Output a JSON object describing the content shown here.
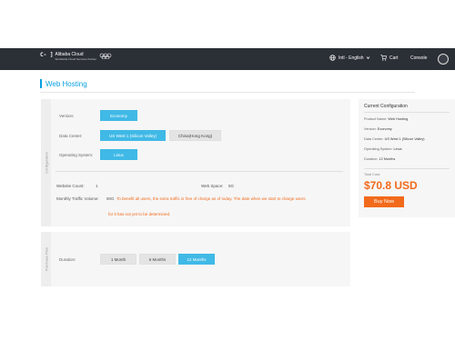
{
  "header": {
    "logo_brand": "Alibaba Cloud",
    "logo_tagline": "Worldwide Cloud Services Partner",
    "language": "Intl - English",
    "cart": "Cart",
    "console": "Console",
    "icons": [
      "alibaba-cloud-logo-icon",
      "olympic-rings-icon",
      "globe-icon",
      "chevron-down-icon",
      "cart-icon",
      "avatar-icon"
    ]
  },
  "page": {
    "title": "Web Hosting"
  },
  "configuration": {
    "section_label": "Configuration",
    "version": {
      "label": "Version:",
      "options": [
        "Economy"
      ],
      "selected": "Economy"
    },
    "data_center": {
      "label": "Data Center:",
      "options": [
        "US West 1 (Silicon Valley)",
        "China(Hong Kong)"
      ],
      "selected": "US West 1 (Silicon Valley)"
    },
    "os": {
      "label": "Operating System:",
      "options": [
        "Linux"
      ],
      "selected": "Linux"
    },
    "website_count": {
      "label": "Website Count:",
      "value": "1"
    },
    "web_space": {
      "label": "Web Space:",
      "value": "5G"
    },
    "traffic": {
      "label": "Monthly Traffic Volume:",
      "value": "50G",
      "note_line1": "To benefit all users, the extra traffic is free of charge as of today. The date when we start to charge users",
      "note_line2": "for it has not yet to be determined."
    }
  },
  "purchase": {
    "section_label": "Purchase Plan",
    "duration": {
      "label": "Duration:",
      "options": [
        "1 Month",
        "6 Months",
        "12 Months"
      ],
      "selected": "12 Months"
    }
  },
  "summary": {
    "title": "Current Configuration",
    "rows": [
      {
        "label": "Product Name:",
        "value": "Web Hosting"
      },
      {
        "label": "Version:",
        "value": "Economy"
      },
      {
        "label": "Data Center:",
        "value": "US West 1 (Silicon Valley)"
      },
      {
        "label": "Operating System:",
        "value": "Linux"
      },
      {
        "label": "Duration:",
        "value": "12 Months"
      }
    ],
    "total_label": "Total Cost:",
    "price": "$70.8 USD",
    "buy_label": "Buy Now"
  },
  "colors": {
    "accent": "#0aa1e1",
    "selected": "#40b9e6",
    "price": "#f26a1b",
    "header_bg": "#2b2f36"
  }
}
